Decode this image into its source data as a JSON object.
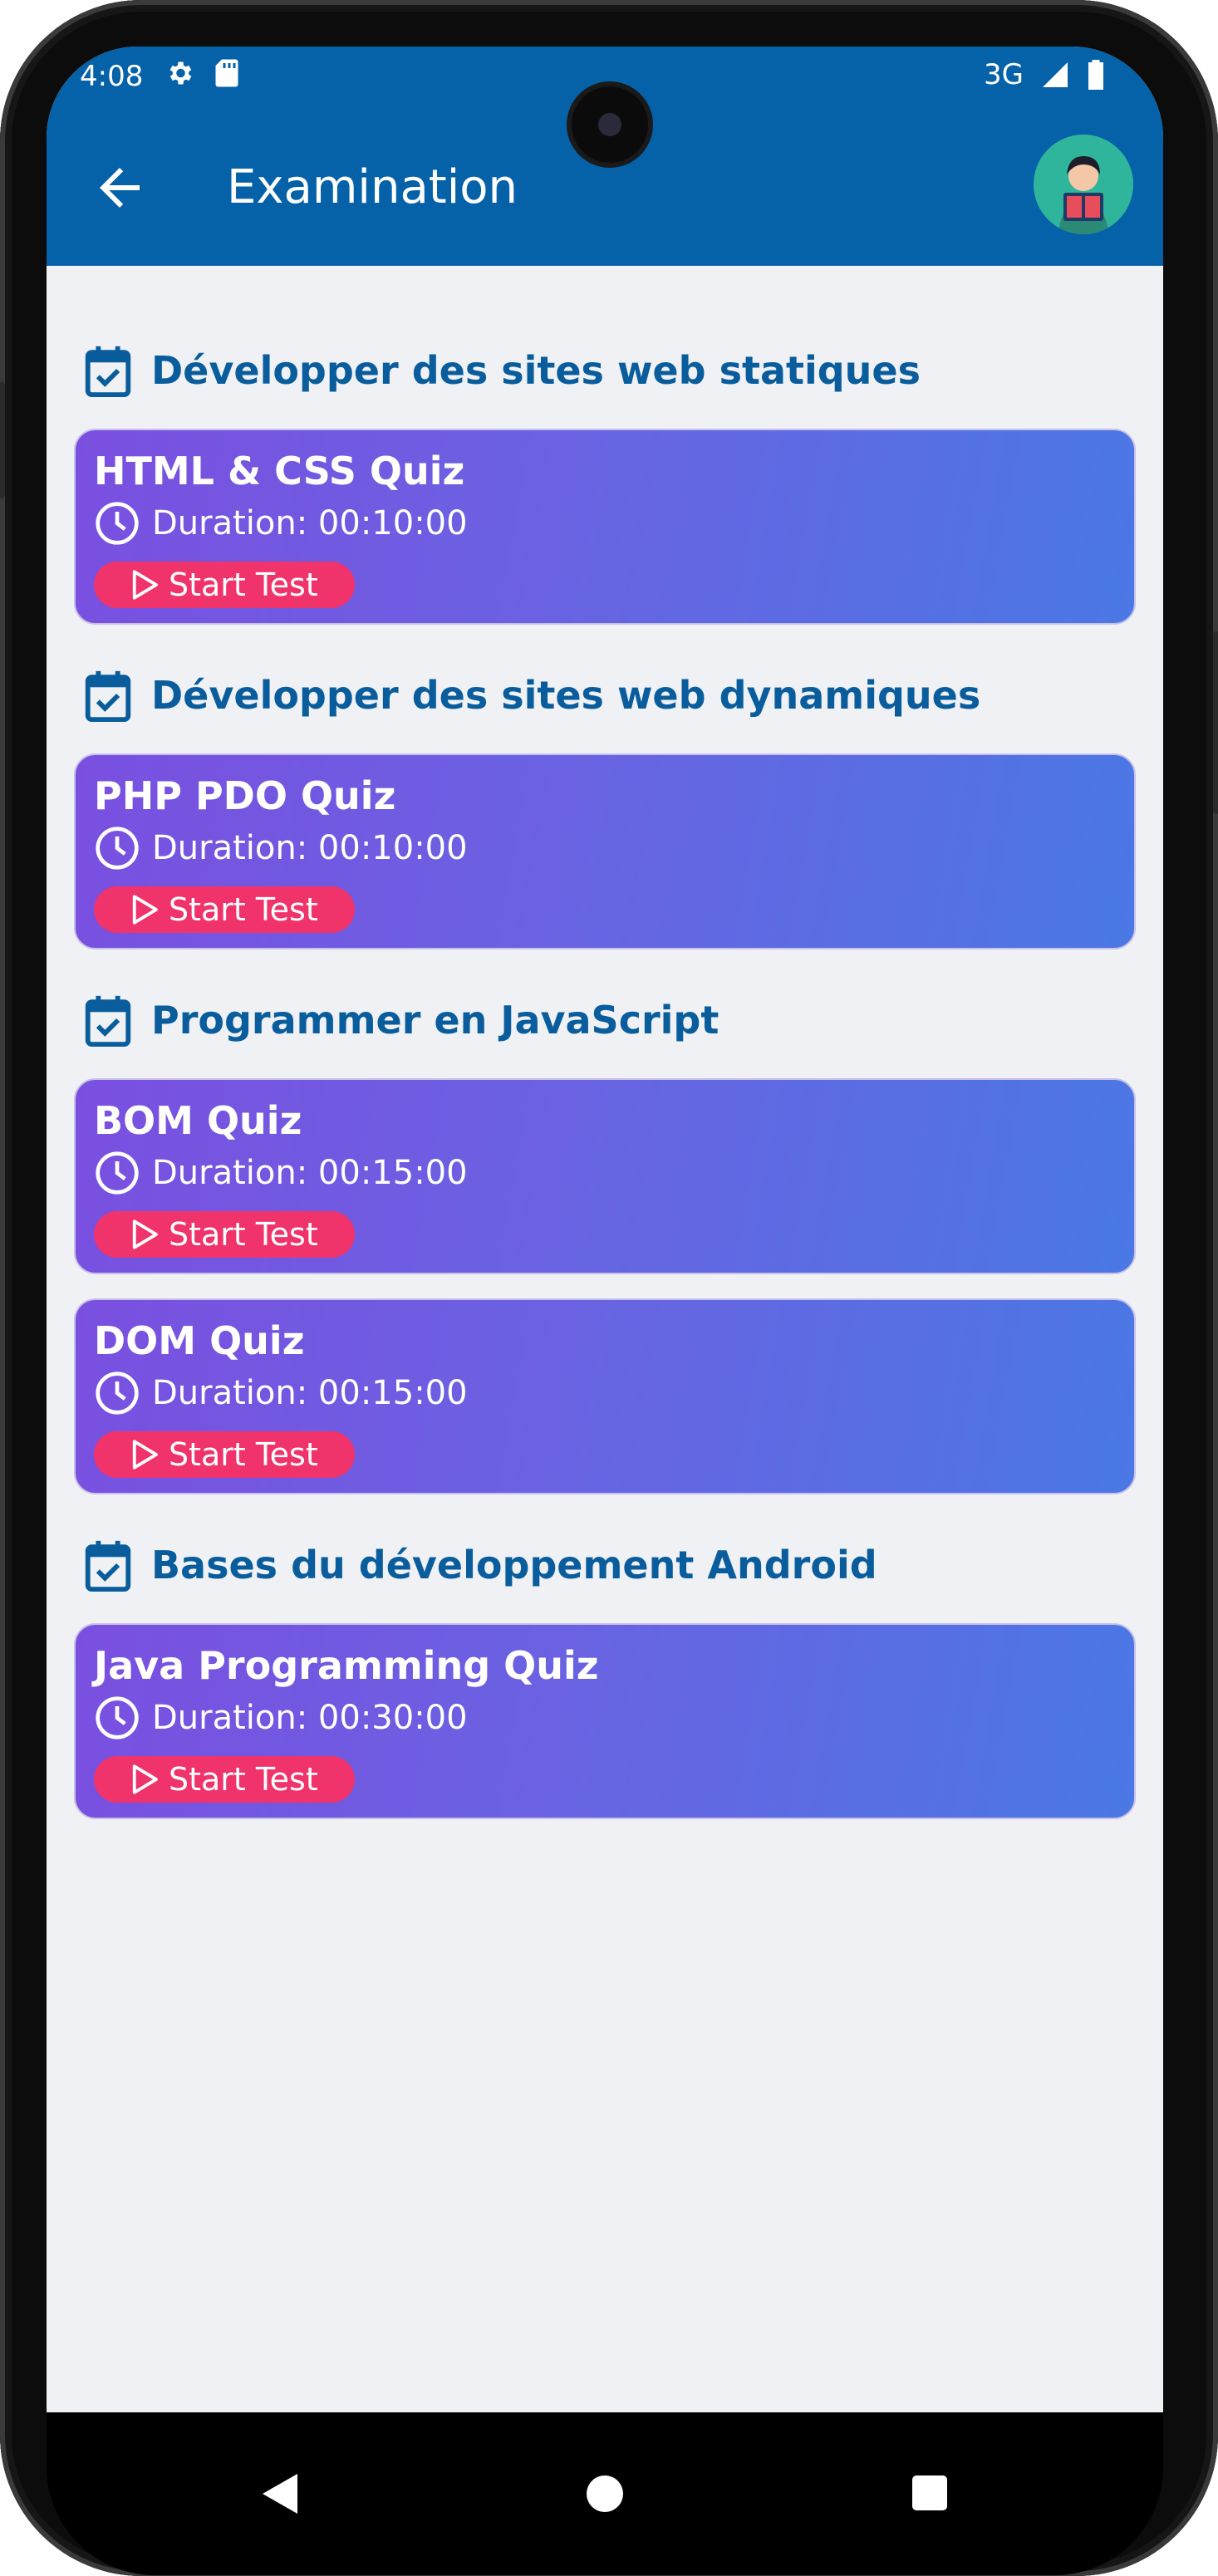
{
  "status_bar": {
    "time": "4:08",
    "network": "3G"
  },
  "app_bar": {
    "title": "Examination"
  },
  "sections": [
    {
      "label": "Développer des sites web statiques",
      "quizzes": [
        {
          "title": "HTML & CSS Quiz",
          "duration": "Duration: 00:10:00",
          "button": "Start Test"
        }
      ]
    },
    {
      "label": "Développer des sites web dynamiques",
      "quizzes": [
        {
          "title": "PHP PDO Quiz",
          "duration": "Duration: 00:10:00",
          "button": "Start Test"
        }
      ]
    },
    {
      "label": "Programmer en JavaScript",
      "quizzes": [
        {
          "title": "BOM Quiz",
          "duration": "Duration: 00:15:00",
          "button": "Start Test"
        },
        {
          "title": "DOM Quiz",
          "duration": "Duration: 00:15:00",
          "button": "Start Test"
        }
      ]
    },
    {
      "label": "Bases du développement Android",
      "quizzes": [
        {
          "title": "Java Programming Quiz",
          "duration": "Duration: 00:30:00",
          "button": "Start Test"
        }
      ]
    }
  ],
  "colors": {
    "app_bar": "#0561a8",
    "section_text": "#0a5d9c",
    "card_gradient_start": "#7a4fe0",
    "card_gradient_end": "#4a78e4",
    "start_button": "#f0336a",
    "background": "#eff1f5"
  },
  "icons": {
    "back": "arrow-left-icon",
    "avatar": "reading-student-avatar",
    "section": "calendar-check-icon",
    "duration": "clock-icon",
    "start": "play-icon",
    "nav_back": "triangle-back-icon",
    "nav_home": "circle-home-icon",
    "nav_recents": "square-recents-icon"
  }
}
